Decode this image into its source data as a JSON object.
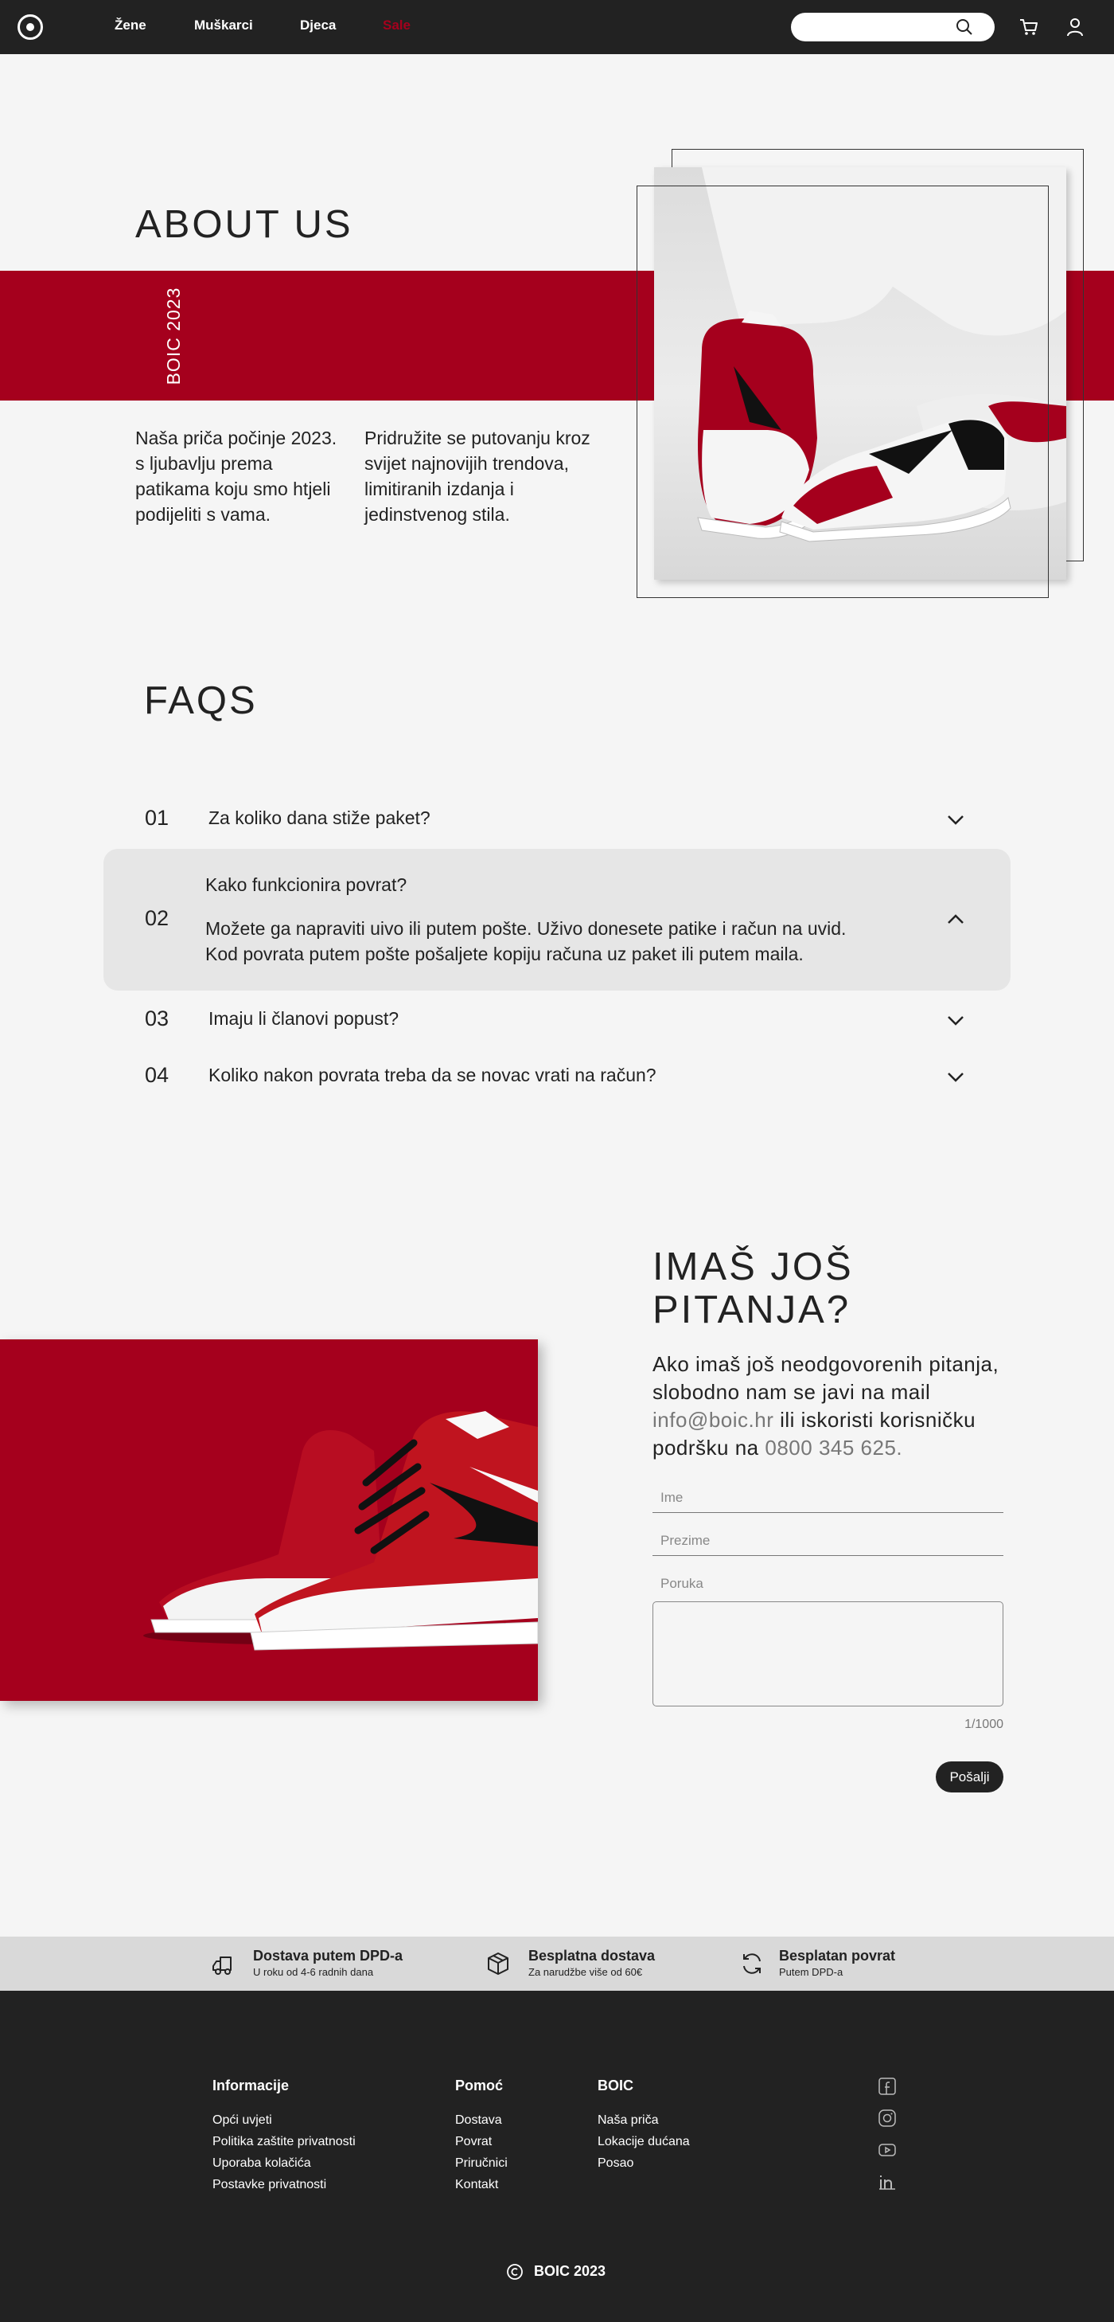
{
  "nav": {
    "links": [
      "Žene",
      "Muškarci",
      "Djeca",
      "Sale"
    ],
    "search_placeholder": "",
    "colors": {
      "background": "#222222",
      "sale": "#a5001d"
    },
    "icons": [
      "logo-icon",
      "search-icon",
      "cart-icon",
      "user-icon"
    ]
  },
  "about": {
    "title": "ABOUT US",
    "vertical_label": "BOIC 2023",
    "paragraph_left": "Naša priča počinje 2023. s ljubavlju prema patikama koju smo htjeli podijeliti s vama.",
    "paragraph_right": "Pridružite se putovanju kroz svijet najnovijih trendova, limitiranih izdanja i jedinstvenog stila.",
    "accent_color": "#a5001d"
  },
  "faq": {
    "title": "FAQS",
    "items": [
      {
        "num": "01",
        "question": "Za koliko dana stiže paket?",
        "open": false
      },
      {
        "num": "02",
        "question": "Kako funkcionira povrat?",
        "open": true,
        "answer_line1": "Možete ga napraviti uivo ili putem pošte. Uživo donesete patike i račun na uvid.",
        "answer_line2": "Kod povrata putem pošte pošaljete kopiju računa uz paket ili putem maila."
      },
      {
        "num": "03",
        "question": "Imaju li članovi popust?",
        "open": false
      },
      {
        "num": "04",
        "question": "Koliko nakon povrata treba da se novac vrati na račun?",
        "open": false
      }
    ]
  },
  "contact": {
    "title_line1": "IMAŠ JOŠ",
    "title_line2": "PITANJA?",
    "text_1": "Ako imaš još neodgovorenih pitanja, slobodno nam se javi na mail ",
    "email": "info@boic.hr",
    "text_2": " ili iskoristi korisničku podršku na ",
    "phone": "0800 345 625.",
    "fields": {
      "first_name": "Ime",
      "last_name": "Prezime",
      "message": "Poruka"
    },
    "counter": "1/1000",
    "send_label": "Pošalji"
  },
  "benefits": [
    {
      "icon": "truck-icon",
      "title": "Dostava putem DPD-a",
      "subtitle": "U roku od 4-6 radnih dana"
    },
    {
      "icon": "package-icon",
      "title": "Besplatna dostava",
      "subtitle": "Za narudžbe više od 60€"
    },
    {
      "icon": "refresh-icon",
      "title": "Besplatan povrat",
      "subtitle": "Putem DPD-a"
    }
  ],
  "footer": {
    "columns": [
      {
        "heading": "Informacije",
        "links": [
          "Opći uvjeti",
          "Politika zaštite privatnosti",
          "Uporaba kolačića",
          "Postavke privatnosti"
        ]
      },
      {
        "heading": "Pomoć",
        "links": [
          "Dostava",
          "Povrat",
          "Priručnici",
          "Kontakt"
        ]
      },
      {
        "heading": "BOIC",
        "links": [
          "Naša priča",
          "Lokacije dućana",
          "Posao"
        ]
      }
    ],
    "social_icons": [
      "facebook-icon",
      "instagram-icon",
      "youtube-icon",
      "linkedin-icon"
    ],
    "copyright": "BOIC 2023"
  }
}
